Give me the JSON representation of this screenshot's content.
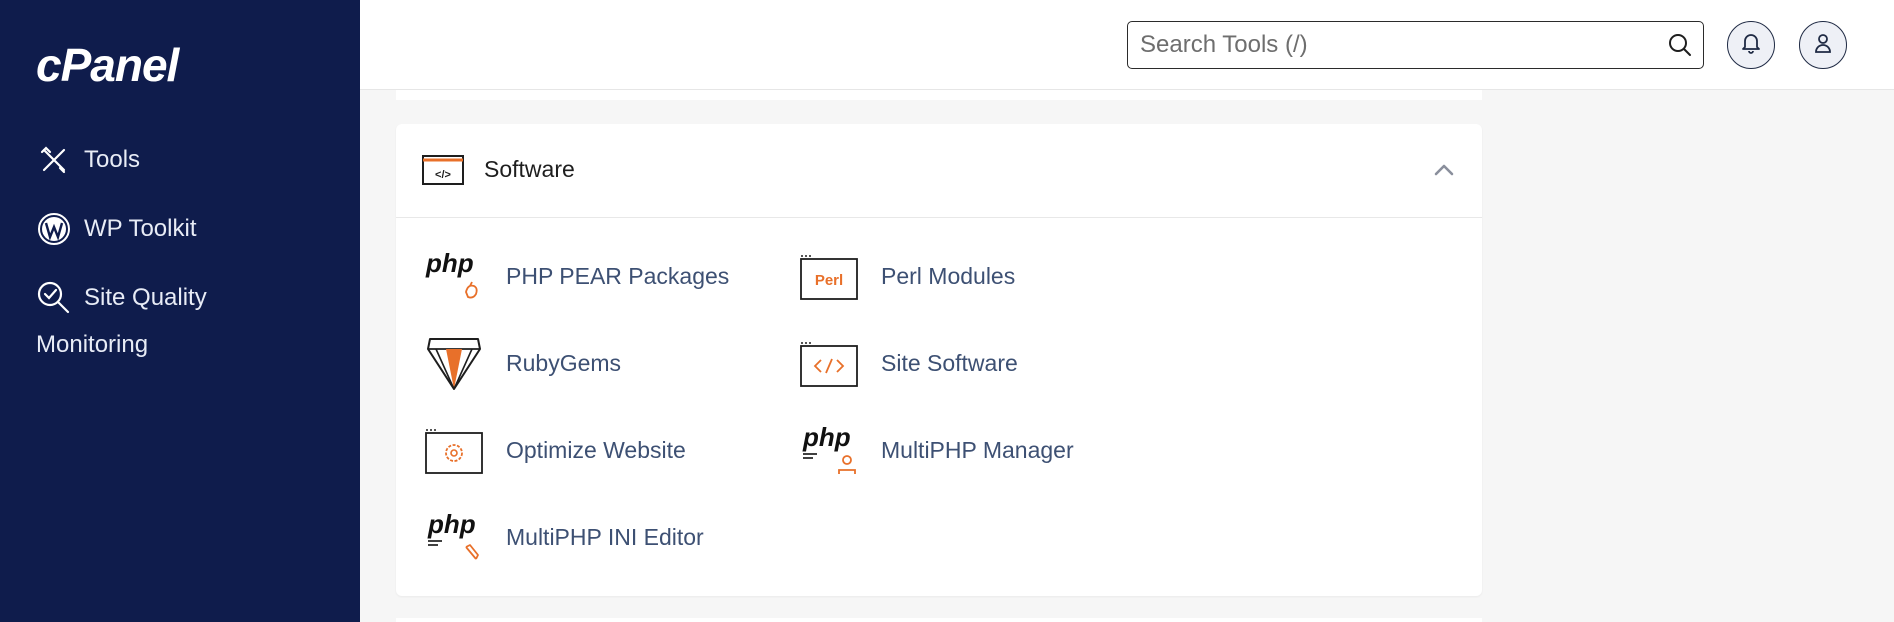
{
  "sidebar": {
    "logo": "cPanel",
    "items": [
      {
        "label": "Tools",
        "icon": "tools-icon"
      },
      {
        "label": "WP Toolkit",
        "icon": "wordpress-icon"
      },
      {
        "label": "Site Quality",
        "label2": "Monitoring",
        "icon": "site-quality-icon"
      }
    ]
  },
  "header": {
    "search_placeholder": "Search Tools (/)",
    "search_value": "",
    "icons": [
      "search-icon",
      "bell-icon",
      "user-icon"
    ]
  },
  "section": {
    "title": "Software",
    "icon": "software-icon",
    "collapse_icon": "chevron-up-icon",
    "tools": [
      {
        "label": "PHP PEAR Packages",
        "icon": "php-pear-icon"
      },
      {
        "label": "Perl Modules",
        "icon": "perl-icon",
        "icon_text": "Perl"
      },
      {
        "label": "RubyGems",
        "icon": "rubygems-icon"
      },
      {
        "label": "Site Software",
        "icon": "site-software-icon"
      },
      {
        "label": "Optimize Website",
        "icon": "optimize-website-icon"
      },
      {
        "label": "MultiPHP Manager",
        "icon": "multiphp-manager-icon"
      },
      {
        "label": "MultiPHP INI Editor",
        "icon": "multiphp-ini-editor-icon"
      }
    ],
    "php_text": "php"
  },
  "colors": {
    "sidebar_bg": "#0f1c4c",
    "accent_orange": "#e8702a",
    "link_text": "#3d5073"
  }
}
